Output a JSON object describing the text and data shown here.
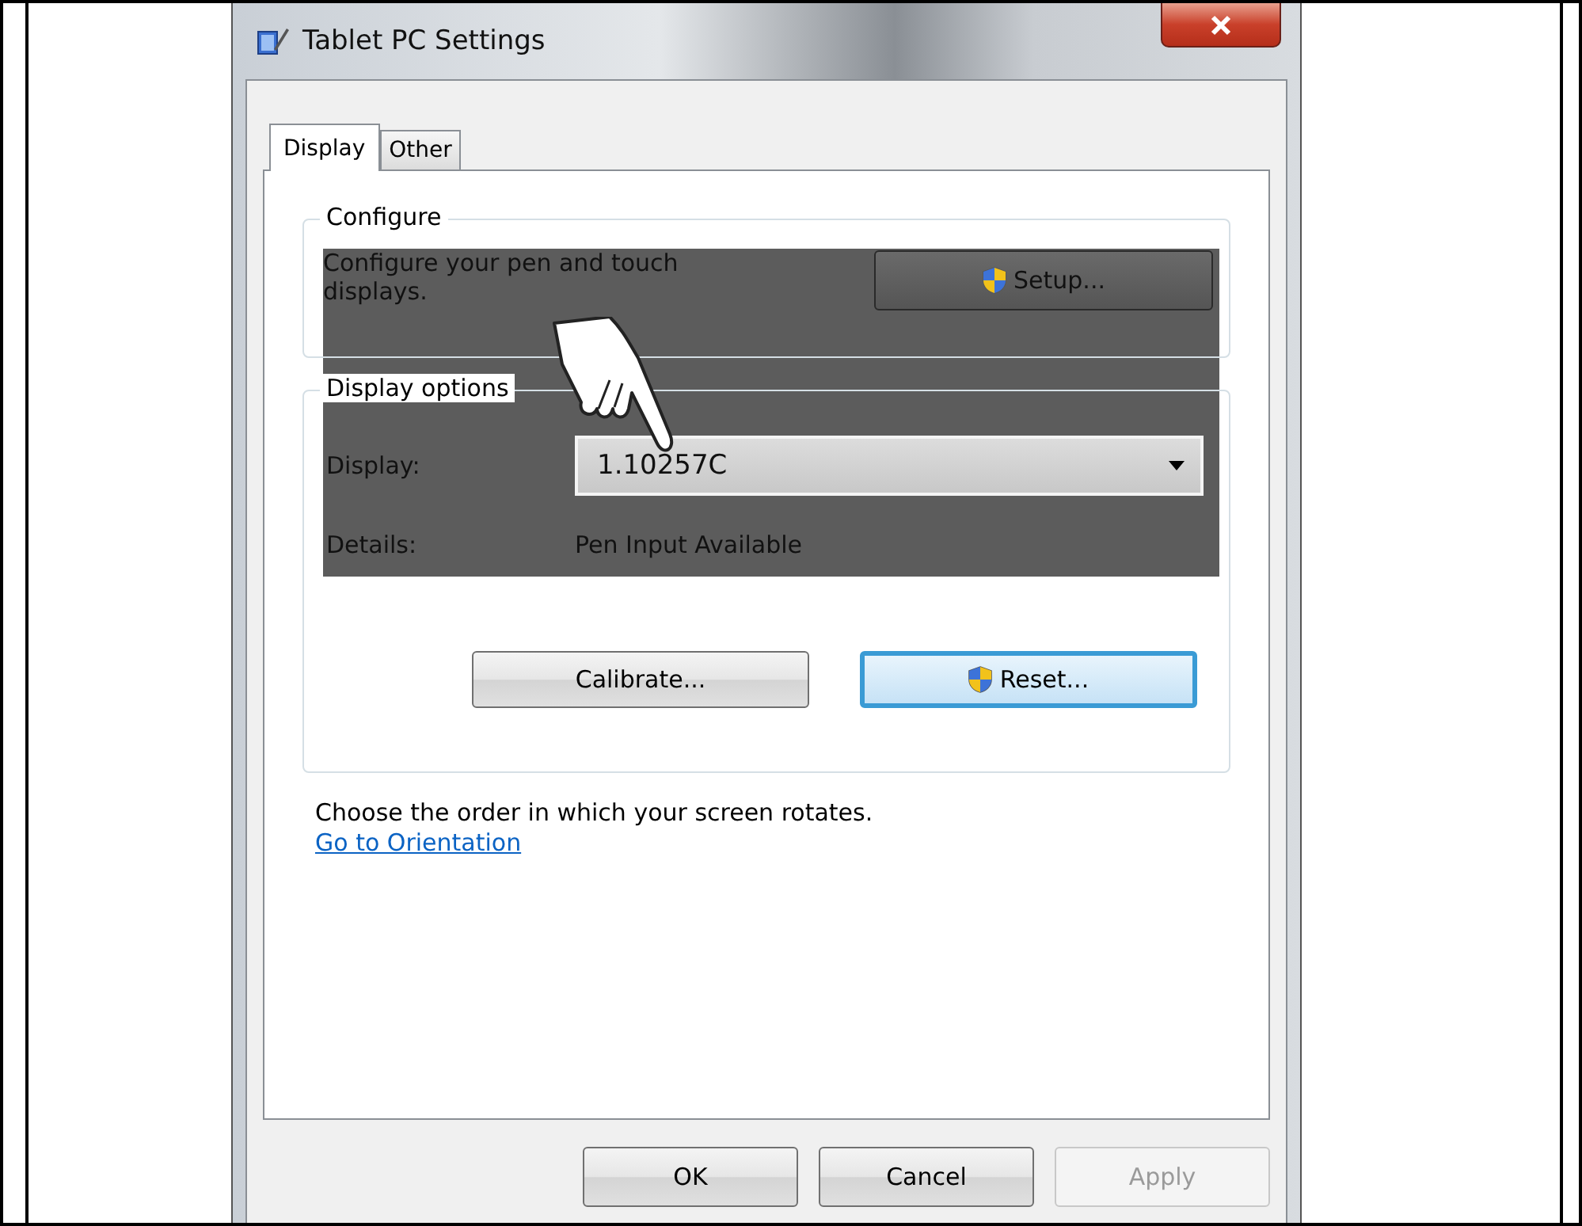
{
  "window": {
    "title": "Tablet PC Settings"
  },
  "tabs": [
    {
      "label": "Display",
      "selected": true
    },
    {
      "label": "Other",
      "selected": false
    }
  ],
  "configure": {
    "title": "Configure",
    "description": "Configure your pen and touch displays.",
    "button": {
      "label": "Setup...",
      "dimmed": true
    }
  },
  "display_options": {
    "title": "Display options",
    "display_label": "Display:",
    "display_value": "1.10257C",
    "display_dimmed": true,
    "details_label": "Details:",
    "details_value": "Pen Input Available",
    "buttons": [
      {
        "label": "Calibrate...",
        "shield": false,
        "focused": false
      },
      {
        "label": "Reset...",
        "shield": true,
        "focused": true
      }
    ]
  },
  "orientation": {
    "text": "Choose the order in which your screen rotates.",
    "link": "Go to Orientation"
  },
  "buttons": [
    {
      "label": "OK",
      "disabled": false
    },
    {
      "label": "Cancel",
      "disabled": false
    },
    {
      "label": "Apply",
      "disabled": true
    }
  ]
}
